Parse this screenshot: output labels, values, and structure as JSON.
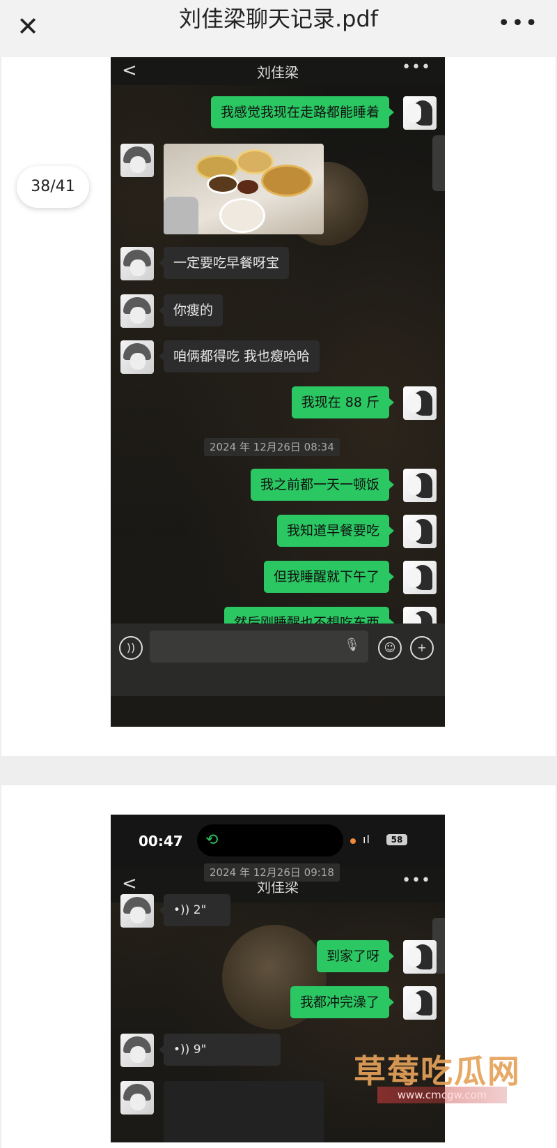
{
  "viewer": {
    "title": "刘佳梁聊天记录.pdf",
    "close_glyph": "✕",
    "more_glyph": "•••",
    "page_indicator": "38/41"
  },
  "screen1": {
    "contact_name": "刘佳梁",
    "back_glyph": "<",
    "more_glyph": "•••",
    "messages": [
      {
        "from": "me",
        "text": "我感觉我现在走路都能睡着"
      },
      {
        "from": "other",
        "type": "image"
      },
      {
        "from": "other",
        "text": "一定要吃早餐呀宝"
      },
      {
        "from": "other",
        "text": "你瘦的"
      },
      {
        "from": "other",
        "text": "咱俩都得吃 我也瘦哈哈"
      },
      {
        "from": "me",
        "text": "我现在 88 斤"
      },
      {
        "from": "me",
        "text": "我之前都一天一顿饭"
      },
      {
        "from": "me",
        "text": "我知道早餐要吃"
      },
      {
        "from": "me",
        "text": "但我睡醒就下午了"
      },
      {
        "from": "me",
        "text": "然后刚睡醒也不想吃东西"
      }
    ],
    "timestamp": "2024 年 12月26日 08:34"
  },
  "screen2": {
    "status_time": "00:47",
    "battery": "58",
    "signal": "ıl",
    "contact_name": "刘佳梁",
    "back_glyph": "<",
    "more_glyph": "•••",
    "timestamp": "2024 年 12月26日 09:18",
    "voice1": "•)) 2\"",
    "msg1": "到家了呀",
    "msg2": "我都冲完澡了",
    "voice2": "•)) 9\""
  },
  "watermark": {
    "title": "草莓吃瓜网",
    "url": "www.cmcgw.com"
  }
}
